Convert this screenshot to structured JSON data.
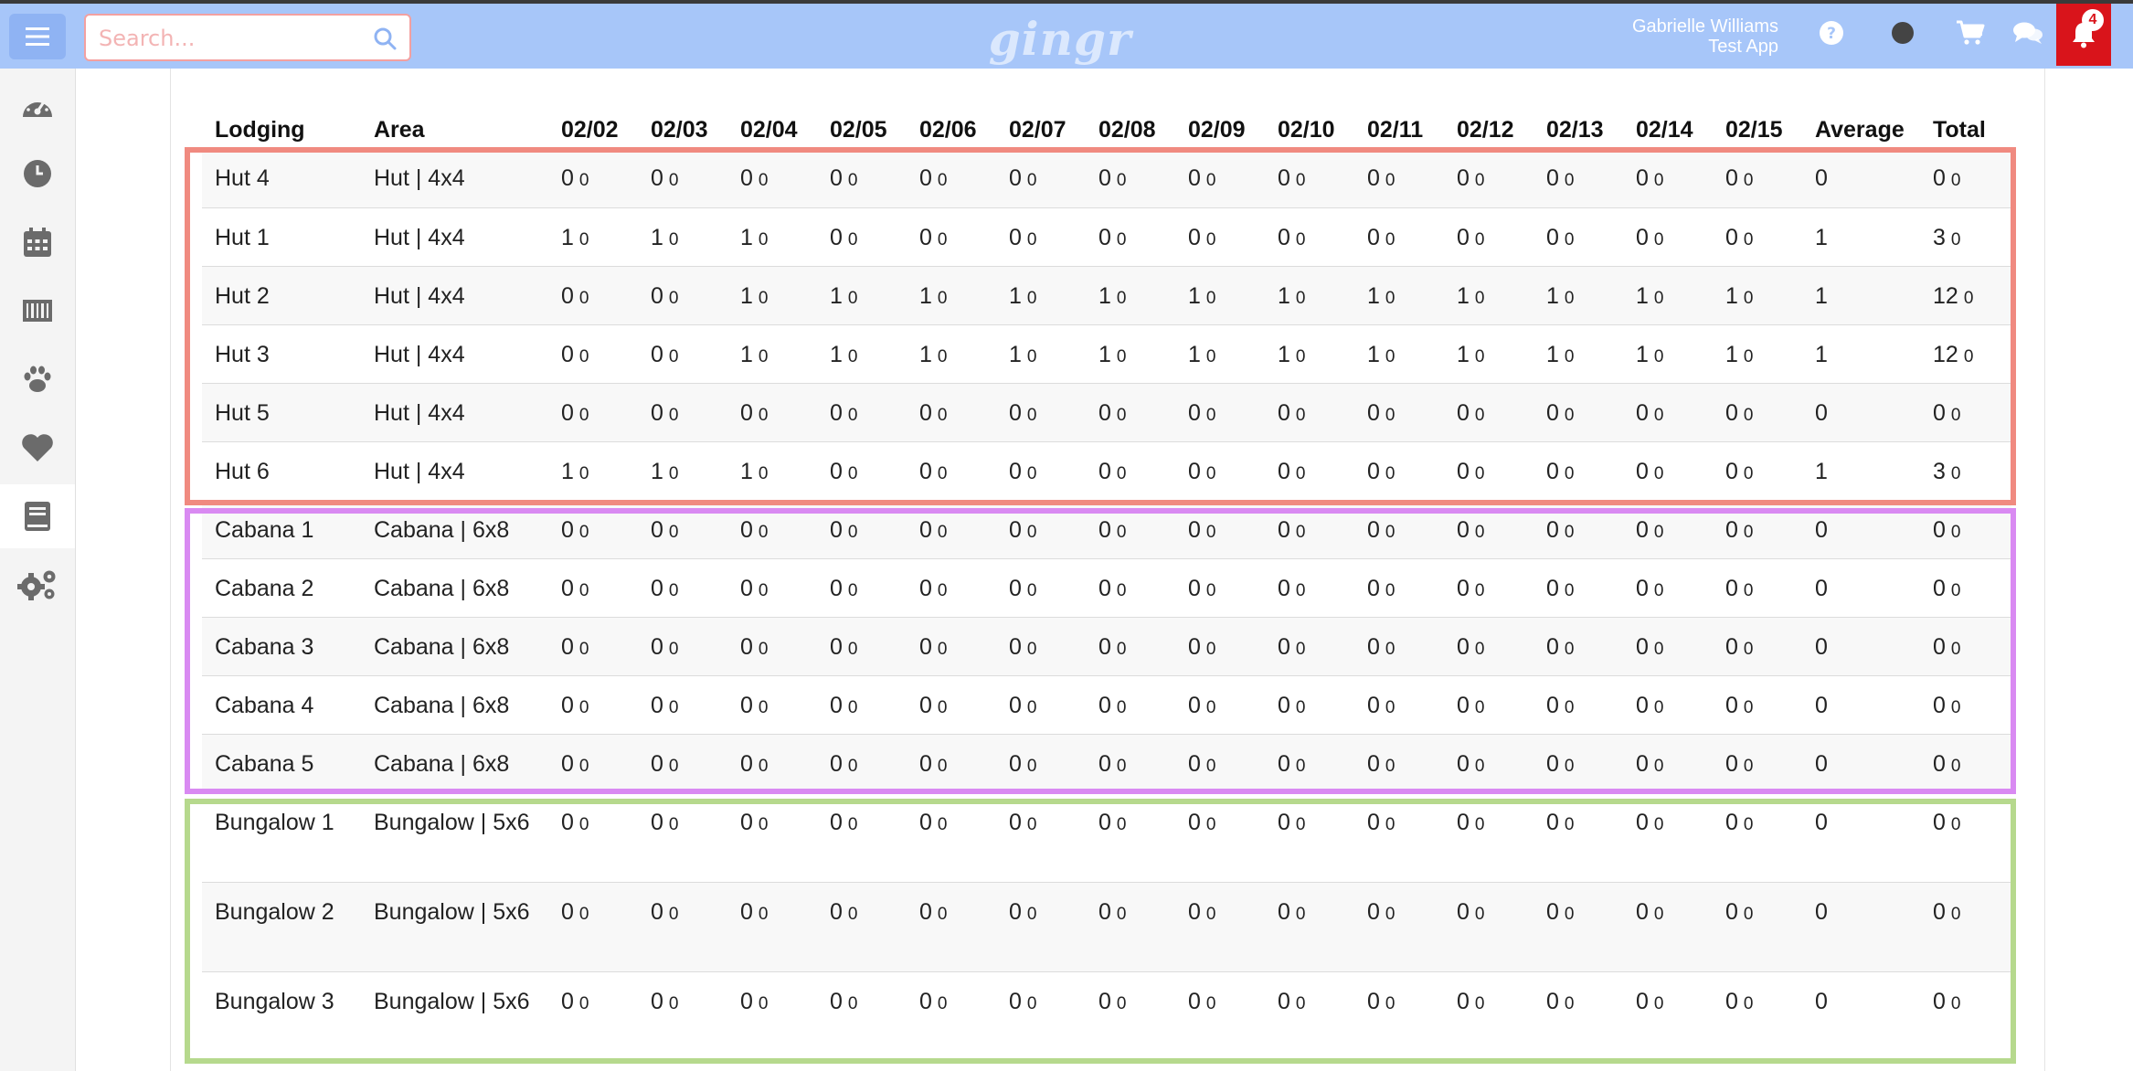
{
  "header": {
    "search_placeholder": "Search...",
    "logo_text": "gingr",
    "user_name": "Gabrielle Williams",
    "app_name": "Test App",
    "notification_count": "4"
  },
  "sidebar": {
    "items": [
      "dashboard-icon",
      "clock-icon",
      "calendar-icon",
      "barcode-icon",
      "paw-icon",
      "heart-icon",
      "book-icon",
      "gears-icon"
    ],
    "active_index": 6
  },
  "table": {
    "columns": [
      "Lodging",
      "Area",
      "02/02",
      "02/03",
      "02/04",
      "02/05",
      "02/06",
      "02/07",
      "02/08",
      "02/09",
      "02/10",
      "02/11",
      "02/12",
      "02/13",
      "02/14",
      "02/15",
      "Average",
      "Total"
    ],
    "rows": [
      {
        "lodging": "Hut 4",
        "area": "Hut | 4x4",
        "days": [
          "0",
          "0",
          "0",
          "0",
          "0",
          "0",
          "0",
          "0",
          "0",
          "0",
          "0",
          "0",
          "0",
          "0"
        ],
        "average": "0",
        "total": "0"
      },
      {
        "lodging": "Hut 1",
        "area": "Hut | 4x4",
        "days": [
          "1",
          "1",
          "1",
          "0",
          "0",
          "0",
          "0",
          "0",
          "0",
          "0",
          "0",
          "0",
          "0",
          "0"
        ],
        "average": "1",
        "total": "3"
      },
      {
        "lodging": "Hut 2",
        "area": "Hut | 4x4",
        "days": [
          "0",
          "0",
          "1",
          "1",
          "1",
          "1",
          "1",
          "1",
          "1",
          "1",
          "1",
          "1",
          "1",
          "1"
        ],
        "average": "1",
        "total": "12"
      },
      {
        "lodging": "Hut 3",
        "area": "Hut | 4x4",
        "days": [
          "0",
          "0",
          "1",
          "1",
          "1",
          "1",
          "1",
          "1",
          "1",
          "1",
          "1",
          "1",
          "1",
          "1"
        ],
        "average": "1",
        "total": "12"
      },
      {
        "lodging": "Hut 5",
        "area": "Hut | 4x4",
        "days": [
          "0",
          "0",
          "0",
          "0",
          "0",
          "0",
          "0",
          "0",
          "0",
          "0",
          "0",
          "0",
          "0",
          "0"
        ],
        "average": "0",
        "total": "0"
      },
      {
        "lodging": "Hut 6",
        "area": "Hut | 4x4",
        "days": [
          "1",
          "1",
          "1",
          "0",
          "0",
          "0",
          "0",
          "0",
          "0",
          "0",
          "0",
          "0",
          "0",
          "0"
        ],
        "average": "1",
        "total": "3"
      },
      {
        "lodging": "Cabana 1",
        "area": "Cabana | 6x8",
        "days": [
          "0",
          "0",
          "0",
          "0",
          "0",
          "0",
          "0",
          "0",
          "0",
          "0",
          "0",
          "0",
          "0",
          "0"
        ],
        "average": "0",
        "total": "0"
      },
      {
        "lodging": "Cabana 2",
        "area": "Cabana | 6x8",
        "days": [
          "0",
          "0",
          "0",
          "0",
          "0",
          "0",
          "0",
          "0",
          "0",
          "0",
          "0",
          "0",
          "0",
          "0"
        ],
        "average": "0",
        "total": "0"
      },
      {
        "lodging": "Cabana 3",
        "area": "Cabana | 6x8",
        "days": [
          "0",
          "0",
          "0",
          "0",
          "0",
          "0",
          "0",
          "0",
          "0",
          "0",
          "0",
          "0",
          "0",
          "0"
        ],
        "average": "0",
        "total": "0"
      },
      {
        "lodging": "Cabana 4",
        "area": "Cabana | 6x8",
        "days": [
          "0",
          "0",
          "0",
          "0",
          "0",
          "0",
          "0",
          "0",
          "0",
          "0",
          "0",
          "0",
          "0",
          "0"
        ],
        "average": "0",
        "total": "0"
      },
      {
        "lodging": "Cabana 5",
        "area": "Cabana | 6x8",
        "days": [
          "0",
          "0",
          "0",
          "0",
          "0",
          "0",
          "0",
          "0",
          "0",
          "0",
          "0",
          "0",
          "0",
          "0"
        ],
        "average": "0",
        "total": "0"
      },
      {
        "lodging": "Bungalow 1",
        "area": "Bungalow | 5x6",
        "days": [
          "0",
          "0",
          "0",
          "0",
          "0",
          "0",
          "0",
          "0",
          "0",
          "0",
          "0",
          "0",
          "0",
          "0"
        ],
        "average": "0",
        "total": "0"
      },
      {
        "lodging": "Bungalow 2",
        "area": "Bungalow | 5x6",
        "days": [
          "0",
          "0",
          "0",
          "0",
          "0",
          "0",
          "0",
          "0",
          "0",
          "0",
          "0",
          "0",
          "0",
          "0"
        ],
        "average": "0",
        "total": "0"
      },
      {
        "lodging": "Bungalow 3",
        "area": "Bungalow | 5x6",
        "days": [
          "0",
          "0",
          "0",
          "0",
          "0",
          "0",
          "0",
          "0",
          "0",
          "0",
          "0",
          "0",
          "0",
          "0"
        ],
        "average": "0",
        "total": "0"
      }
    ],
    "secondary_value": "0"
  },
  "colors": {
    "header_bg": "#a7c6f9",
    "hut_group_border": "#f08a80",
    "cabana_group_border": "#d98af2",
    "bungalow_group_border": "#b6d98d",
    "notification_red": "#d9141b"
  }
}
